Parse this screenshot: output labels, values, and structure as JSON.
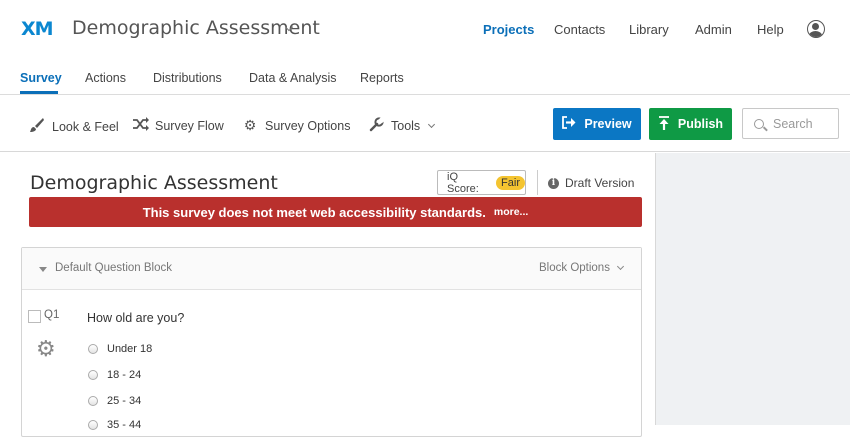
{
  "app": {
    "logo": "XM",
    "project_title": "Demographic Assessment"
  },
  "top_nav": [
    {
      "label": "Projects",
      "active": true
    },
    {
      "label": "Contacts"
    },
    {
      "label": "Library"
    },
    {
      "label": "Admin"
    },
    {
      "label": "Help"
    }
  ],
  "tabs": [
    {
      "label": "Survey",
      "active": true
    },
    {
      "label": "Actions"
    },
    {
      "label": "Distributions"
    },
    {
      "label": "Data & Analysis"
    },
    {
      "label": "Reports"
    }
  ],
  "toolbar": {
    "look_feel": "Look & Feel",
    "survey_flow": "Survey Flow",
    "survey_options": "Survey Options",
    "tools": "Tools",
    "preview": "Preview",
    "publish": "Publish",
    "search_placeholder": "Search"
  },
  "survey": {
    "title": "Demographic Assessment",
    "iq_label": "iQ Score:",
    "iq_value": "Fair",
    "draft": "Draft Version",
    "alert_text": "This survey does not meet web accessibility standards.",
    "alert_more": "more..."
  },
  "block": {
    "name": "Default Question Block",
    "options": "Block Options"
  },
  "question": {
    "number": "Q1",
    "text": "How old are you?",
    "choices": [
      "Under 18",
      "18 - 24",
      "25 - 34",
      "35 - 44"
    ]
  },
  "colors": {
    "accent": "#0b6fb8",
    "preview": "#0b77c4",
    "publish": "#0f9a45",
    "alert": "#b9302d",
    "iq_badge": "#f4c430"
  }
}
